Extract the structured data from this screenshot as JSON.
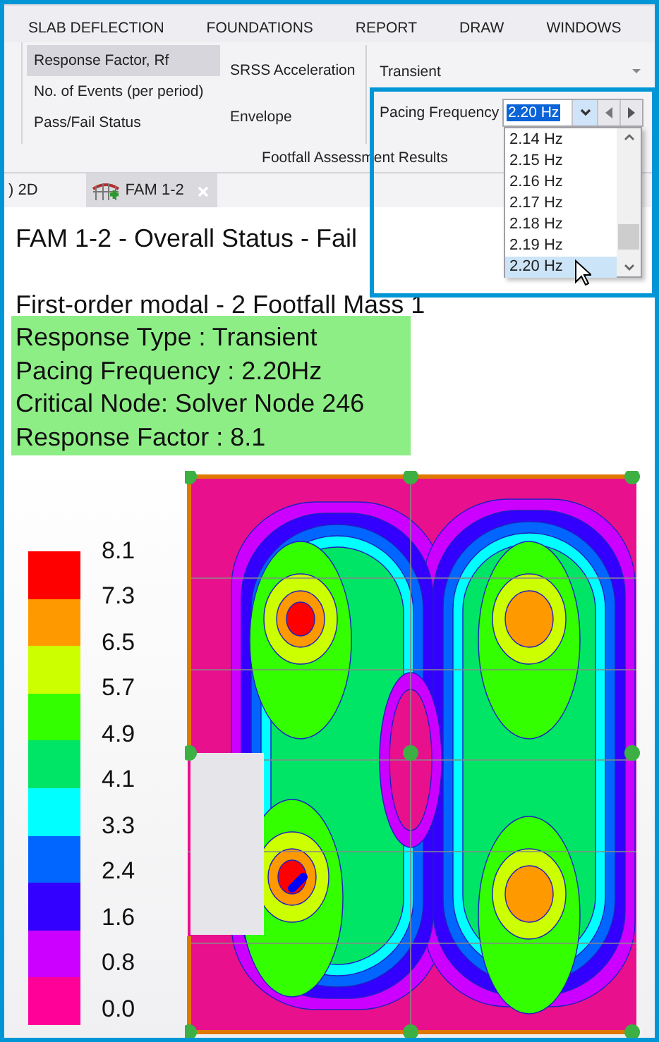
{
  "menu": [
    {
      "label": "SLAB DEFLECTION"
    },
    {
      "label": "FOUNDATIONS"
    },
    {
      "label": "REPORT"
    },
    {
      "label": "DRAW"
    },
    {
      "label": "WINDOWS"
    }
  ],
  "ribbon": {
    "result_types": [
      {
        "label": "Response Factor, Rf",
        "selected": true
      },
      {
        "label": "No. of Events (per period)",
        "selected": false
      },
      {
        "label": "Pass/Fail Status",
        "selected": false
      }
    ],
    "options": [
      {
        "label": "SRSS Acceleration"
      },
      {
        "label": "Envelope"
      }
    ],
    "response_type": {
      "value": "Transient"
    },
    "pacing_frequency": {
      "label": "Pacing Frequency",
      "value": "2.20 Hz"
    },
    "group_label": "Footfall Assessment Results"
  },
  "frequency_list": [
    {
      "label": "2.14 Hz",
      "selected": false
    },
    {
      "label": "2.15 Hz",
      "selected": false
    },
    {
      "label": "2.16 Hz",
      "selected": false
    },
    {
      "label": "2.17 Hz",
      "selected": false
    },
    {
      "label": "2.18 Hz",
      "selected": false
    },
    {
      "label": "2.19 Hz",
      "selected": false
    },
    {
      "label": "2.20 Hz",
      "selected": true
    }
  ],
  "tabs": [
    {
      "label": ") 2D",
      "selected": false,
      "closable": false
    },
    {
      "label": "FAM 1-2",
      "selected": true,
      "closable": true
    }
  ],
  "document": {
    "title": "FAM 1-2 - Overall Status - Fail",
    "subtitle": "First-order modal - 2 Footfall Mass 1",
    "info_lines": [
      "Response Type : Transient",
      "Pacing Frequency : 2.20Hz",
      "Critical Node: Solver Node 246",
      "Response Factor : 8.1"
    ]
  },
  "legend": {
    "labels": [
      "8.1",
      "7.3",
      "6.5",
      "5.7",
      "4.9",
      "4.1",
      "3.3",
      "2.4",
      "1.6",
      "0.8",
      "0.0"
    ],
    "bands": [
      {
        "color": "#ff0000"
      },
      {
        "color": "#ff9900"
      },
      {
        "color": "#ccff00"
      },
      {
        "color": "#33ff00"
      },
      {
        "color": "#00e566"
      },
      {
        "color": "#00ffff"
      },
      {
        "color": "#0066ff"
      },
      {
        "color": "#3300ff"
      },
      {
        "color": "#cc00ff"
      },
      {
        "color": "#ff0099"
      }
    ]
  }
}
